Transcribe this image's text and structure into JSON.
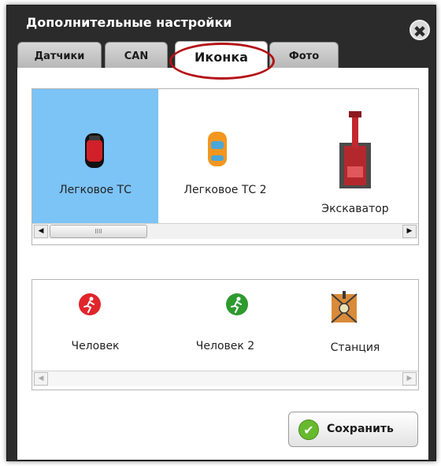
{
  "dialog": {
    "title": "Дополнительные настройки",
    "close_glyph": "✖"
  },
  "tabs": [
    {
      "label": "Датчики",
      "active": false
    },
    {
      "label": "CAN",
      "active": false
    },
    {
      "label": "Иконка",
      "active": true
    },
    {
      "label": "Фото",
      "active": false
    }
  ],
  "vehicles": [
    {
      "label": "Легковое ТС",
      "icon": "red-car-icon",
      "selected": true
    },
    {
      "label": "Легковое ТС 2",
      "icon": "orange-car-icon",
      "selected": false
    },
    {
      "label": "Экскаватор",
      "icon": "excavator-icon",
      "selected": false
    }
  ],
  "people": [
    {
      "label": "Человек",
      "icon": "red-runner-icon"
    },
    {
      "label": "Человек 2",
      "icon": "green-runner-icon"
    },
    {
      "label": "Станция",
      "icon": "station-icon"
    }
  ],
  "scroll": {
    "left_arrow": "◀",
    "right_arrow": "▶",
    "thumb_grip": "IIII"
  },
  "save_button": {
    "label": "Сохранить",
    "check_glyph": "✔"
  },
  "colors": {
    "selected_bg": "#7cc3f6",
    "titlebar": "#2b2b2b",
    "highlight_ring": "#b31217",
    "save_check": "#67b92e"
  }
}
